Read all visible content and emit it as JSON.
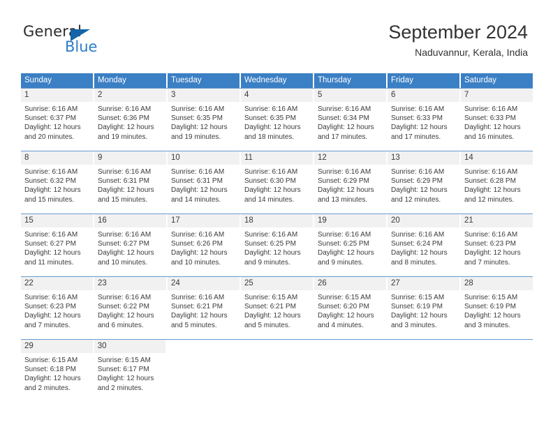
{
  "logo": {
    "word_one": "General",
    "word_two": "Blue",
    "flag_icon": "blue-triangle-flag",
    "colors": {
      "general": "#2b2b2b",
      "blue": "#2b7cc9",
      "flag": "#1565a8"
    }
  },
  "header": {
    "title": "September 2024",
    "subtitle": "Naduvannur, Kerala, India"
  },
  "theme": {
    "header_bg": "#3b7fc4",
    "header_text": "#ffffff",
    "daynum_bg": "#f1f1f1",
    "separator": "#6a9ad0",
    "body_text": "#3a3a3a"
  },
  "weekday_headers": [
    "Sunday",
    "Monday",
    "Tuesday",
    "Wednesday",
    "Thursday",
    "Friday",
    "Saturday"
  ],
  "weeks": [
    [
      {
        "day": "1",
        "sunrise": "Sunrise: 6:16 AM",
        "sunset": "Sunset: 6:37 PM",
        "daylight1": "Daylight: 12 hours",
        "daylight2": "and 20 minutes."
      },
      {
        "day": "2",
        "sunrise": "Sunrise: 6:16 AM",
        "sunset": "Sunset: 6:36 PM",
        "daylight1": "Daylight: 12 hours",
        "daylight2": "and 19 minutes."
      },
      {
        "day": "3",
        "sunrise": "Sunrise: 6:16 AM",
        "sunset": "Sunset: 6:35 PM",
        "daylight1": "Daylight: 12 hours",
        "daylight2": "and 19 minutes."
      },
      {
        "day": "4",
        "sunrise": "Sunrise: 6:16 AM",
        "sunset": "Sunset: 6:35 PM",
        "daylight1": "Daylight: 12 hours",
        "daylight2": "and 18 minutes."
      },
      {
        "day": "5",
        "sunrise": "Sunrise: 6:16 AM",
        "sunset": "Sunset: 6:34 PM",
        "daylight1": "Daylight: 12 hours",
        "daylight2": "and 17 minutes."
      },
      {
        "day": "6",
        "sunrise": "Sunrise: 6:16 AM",
        "sunset": "Sunset: 6:33 PM",
        "daylight1": "Daylight: 12 hours",
        "daylight2": "and 17 minutes."
      },
      {
        "day": "7",
        "sunrise": "Sunrise: 6:16 AM",
        "sunset": "Sunset: 6:33 PM",
        "daylight1": "Daylight: 12 hours",
        "daylight2": "and 16 minutes."
      }
    ],
    [
      {
        "day": "8",
        "sunrise": "Sunrise: 6:16 AM",
        "sunset": "Sunset: 6:32 PM",
        "daylight1": "Daylight: 12 hours",
        "daylight2": "and 15 minutes."
      },
      {
        "day": "9",
        "sunrise": "Sunrise: 6:16 AM",
        "sunset": "Sunset: 6:31 PM",
        "daylight1": "Daylight: 12 hours",
        "daylight2": "and 15 minutes."
      },
      {
        "day": "10",
        "sunrise": "Sunrise: 6:16 AM",
        "sunset": "Sunset: 6:31 PM",
        "daylight1": "Daylight: 12 hours",
        "daylight2": "and 14 minutes."
      },
      {
        "day": "11",
        "sunrise": "Sunrise: 6:16 AM",
        "sunset": "Sunset: 6:30 PM",
        "daylight1": "Daylight: 12 hours",
        "daylight2": "and 14 minutes."
      },
      {
        "day": "12",
        "sunrise": "Sunrise: 6:16 AM",
        "sunset": "Sunset: 6:29 PM",
        "daylight1": "Daylight: 12 hours",
        "daylight2": "and 13 minutes."
      },
      {
        "day": "13",
        "sunrise": "Sunrise: 6:16 AM",
        "sunset": "Sunset: 6:29 PM",
        "daylight1": "Daylight: 12 hours",
        "daylight2": "and 12 minutes."
      },
      {
        "day": "14",
        "sunrise": "Sunrise: 6:16 AM",
        "sunset": "Sunset: 6:28 PM",
        "daylight1": "Daylight: 12 hours",
        "daylight2": "and 12 minutes."
      }
    ],
    [
      {
        "day": "15",
        "sunrise": "Sunrise: 6:16 AM",
        "sunset": "Sunset: 6:27 PM",
        "daylight1": "Daylight: 12 hours",
        "daylight2": "and 11 minutes."
      },
      {
        "day": "16",
        "sunrise": "Sunrise: 6:16 AM",
        "sunset": "Sunset: 6:27 PM",
        "daylight1": "Daylight: 12 hours",
        "daylight2": "and 10 minutes."
      },
      {
        "day": "17",
        "sunrise": "Sunrise: 6:16 AM",
        "sunset": "Sunset: 6:26 PM",
        "daylight1": "Daylight: 12 hours",
        "daylight2": "and 10 minutes."
      },
      {
        "day": "18",
        "sunrise": "Sunrise: 6:16 AM",
        "sunset": "Sunset: 6:25 PM",
        "daylight1": "Daylight: 12 hours",
        "daylight2": "and 9 minutes."
      },
      {
        "day": "19",
        "sunrise": "Sunrise: 6:16 AM",
        "sunset": "Sunset: 6:25 PM",
        "daylight1": "Daylight: 12 hours",
        "daylight2": "and 9 minutes."
      },
      {
        "day": "20",
        "sunrise": "Sunrise: 6:16 AM",
        "sunset": "Sunset: 6:24 PM",
        "daylight1": "Daylight: 12 hours",
        "daylight2": "and 8 minutes."
      },
      {
        "day": "21",
        "sunrise": "Sunrise: 6:16 AM",
        "sunset": "Sunset: 6:23 PM",
        "daylight1": "Daylight: 12 hours",
        "daylight2": "and 7 minutes."
      }
    ],
    [
      {
        "day": "22",
        "sunrise": "Sunrise: 6:16 AM",
        "sunset": "Sunset: 6:23 PM",
        "daylight1": "Daylight: 12 hours",
        "daylight2": "and 7 minutes."
      },
      {
        "day": "23",
        "sunrise": "Sunrise: 6:16 AM",
        "sunset": "Sunset: 6:22 PM",
        "daylight1": "Daylight: 12 hours",
        "daylight2": "and 6 minutes."
      },
      {
        "day": "24",
        "sunrise": "Sunrise: 6:16 AM",
        "sunset": "Sunset: 6:21 PM",
        "daylight1": "Daylight: 12 hours",
        "daylight2": "and 5 minutes."
      },
      {
        "day": "25",
        "sunrise": "Sunrise: 6:15 AM",
        "sunset": "Sunset: 6:21 PM",
        "daylight1": "Daylight: 12 hours",
        "daylight2": "and 5 minutes."
      },
      {
        "day": "26",
        "sunrise": "Sunrise: 6:15 AM",
        "sunset": "Sunset: 6:20 PM",
        "daylight1": "Daylight: 12 hours",
        "daylight2": "and 4 minutes."
      },
      {
        "day": "27",
        "sunrise": "Sunrise: 6:15 AM",
        "sunset": "Sunset: 6:19 PM",
        "daylight1": "Daylight: 12 hours",
        "daylight2": "and 3 minutes."
      },
      {
        "day": "28",
        "sunrise": "Sunrise: 6:15 AM",
        "sunset": "Sunset: 6:19 PM",
        "daylight1": "Daylight: 12 hours",
        "daylight2": "and 3 minutes."
      }
    ],
    [
      {
        "day": "29",
        "sunrise": "Sunrise: 6:15 AM",
        "sunset": "Sunset: 6:18 PM",
        "daylight1": "Daylight: 12 hours",
        "daylight2": "and 2 minutes."
      },
      {
        "day": "30",
        "sunrise": "Sunrise: 6:15 AM",
        "sunset": "Sunset: 6:17 PM",
        "daylight1": "Daylight: 12 hours",
        "daylight2": "and 2 minutes."
      },
      null,
      null,
      null,
      null,
      null
    ]
  ]
}
